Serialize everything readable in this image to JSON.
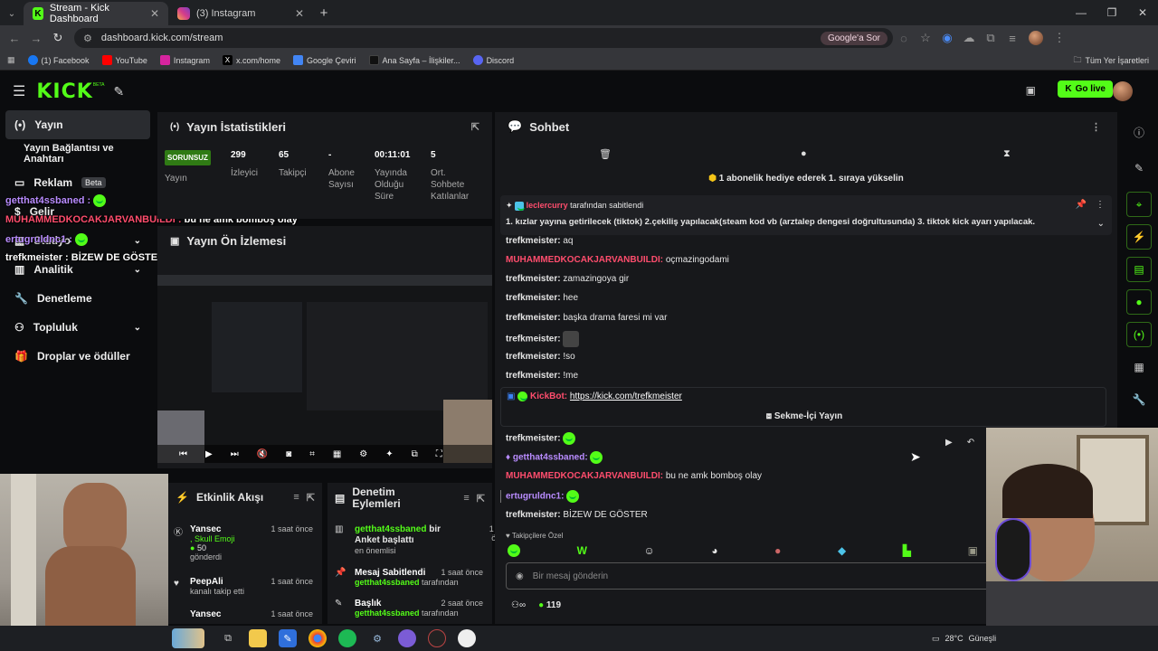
{
  "browser": {
    "tabs": [
      {
        "label": "Stream - Kick Dashboard"
      },
      {
        "label": "(3) Instagram"
      }
    ],
    "url": "dashboard.kick.com/stream",
    "ask_label": "Google'a Sor",
    "bookmarks": [
      {
        "label": "(1) Facebook",
        "color": "#1877f2"
      },
      {
        "label": "YouTube",
        "color": "#ff0000"
      },
      {
        "label": "Instagram",
        "color": "#d6249f"
      },
      {
        "label": "x.com/home",
        "color": "#000000"
      },
      {
        "label": "Google Çeviri",
        "color": "#4285f4"
      },
      {
        "label": "Ana Sayfa – İlişkiler...",
        "color": "#111111"
      },
      {
        "label": "Discord",
        "color": "#5865f2"
      }
    ],
    "all_bookmarks": "Tüm Yer İşaretleri"
  },
  "header": {
    "logo": "KICK",
    "logo_sup": "BETA",
    "go_live": "Go live",
    "accent": "#53fc18"
  },
  "sidebar": {
    "items": [
      {
        "label": "Yayın",
        "icon": "broadcast-icon"
      },
      {
        "label": "Yayın Bağlantısı ve Anahtarı"
      },
      {
        "label": "Reklam",
        "badge": "Beta"
      },
      {
        "label": "Gelir"
      },
      {
        "label": "Stüdyo"
      },
      {
        "label": "Analitik"
      },
      {
        "label": "Denetleme"
      },
      {
        "label": "Topluluk"
      },
      {
        "label": "Droplar ve ödüller"
      }
    ]
  },
  "overlay": {
    "lines": [
      {
        "user": "getthat4ssbaned :",
        "msg": ""
      },
      {
        "user": "MUHAMMEDKOCAKJARVANBUILDI :",
        "msg": "bu ne amk bomboş olay"
      },
      {
        "user": "ertugruldnc1 :",
        "msg": ""
      },
      {
        "user": "trefkmeister :",
        "msg": "BİZEW DE GÖSTER"
      }
    ]
  },
  "stats": {
    "title": "Yayın İstatistikleri",
    "status": "SORUNSUZ",
    "status_label": "Yayın",
    "items": [
      {
        "value": "299",
        "label": "İzleyici"
      },
      {
        "value": "65",
        "label": "Takipçi"
      },
      {
        "value": "-",
        "label": "Abone Sayısı"
      },
      {
        "value": "00:11:01",
        "label": "Yayında Olduğu Süre"
      },
      {
        "value": "5",
        "label": "Ort. Sohbete Katılanlar"
      }
    ]
  },
  "preview": {
    "title": "Yayın Ön İzlemesi"
  },
  "activity": {
    "title": "Etkinlik Akışı",
    "items": [
      {
        "name": "Yansec",
        "time": "1 saat önce",
        "detail": ", Skull Emoji",
        "amount": "50",
        "sub": "gönderdi"
      },
      {
        "name": "PeepAli",
        "time": "1 saat önce",
        "sub": "kanalı takip etti"
      },
      {
        "name": "Yansec",
        "time": "1 saat önce"
      }
    ]
  },
  "modactions": {
    "title": "Denetim Eylemleri",
    "items": [
      {
        "user": "getthat4ssbaned",
        "text": "bir Anket başlattı",
        "time": "1 saat önce",
        "sub": "en önemlisi"
      },
      {
        "title": "Mesaj Sabitlendi",
        "time": "1 saat önce",
        "user": "getthat4ssbaned",
        "sub": "tarafından"
      },
      {
        "title": "Başlık",
        "time": "2 saat önce",
        "user": "getthat4ssbaned",
        "sub": "tarafından"
      }
    ]
  },
  "chat": {
    "title": "Sohbet",
    "gift_banner": "1 abonelik hediye ederek 1. sıraya yükselin",
    "pinned_by": "leclercurry",
    "pinned_by_suffix": "tarafından sabitlendi",
    "pinned_text": "1. kızlar yayına getirilecek (tiktok) 2.çekiliş yapılacak(steam kod vb (arztalep dengesi doğrultusunda) 3. tiktok kick ayarı yapılacak.",
    "messages": [
      {
        "user": "trefkmeister:",
        "msg": "aq",
        "color": "#e5e5e5"
      },
      {
        "user": "MUHAMMEDKOCAKJARVANBUILDI:",
        "msg": "oçmazingodami",
        "color": "#ff4d6d"
      },
      {
        "user": "trefkmeister:",
        "msg": "zamazingoya gir",
        "color": "#e5e5e5"
      },
      {
        "user": "trefkmeister:",
        "msg": "hee",
        "color": "#e5e5e5"
      },
      {
        "user": "trefkmeister:",
        "msg": "başka drama faresi mi var",
        "color": "#e5e5e5"
      },
      {
        "user": "trefkmeister:",
        "msg": "",
        "color": "#e5e5e5"
      },
      {
        "user": "trefkmeister:",
        "msg": "!so",
        "color": "#e5e5e5"
      },
      {
        "user": "trefkmeister:",
        "msg": "!me",
        "color": "#e5e5e5"
      }
    ],
    "bot_user": "KickBot:",
    "bot_link": "https://kick.com/trefkmeister",
    "inner_stream": "Sekme-İçi Yayın",
    "messages2": [
      {
        "user": "trefkmeister:",
        "msg": "",
        "color": "#e5e5e5"
      },
      {
        "user": "getthat4ssbaned:",
        "msg": "",
        "color": "#b98cff"
      },
      {
        "user": "MUHAMMEDKOCAKJARVANBUILDI:",
        "msg": "bu ne amk bomboş olay",
        "color": "#ff4d6d"
      },
      {
        "user": "ertugruldnc1:",
        "msg": "",
        "color": "#b98cff"
      },
      {
        "user": "trefkmeister:",
        "msg": "BİZEW DE GÖSTER",
        "color": "#e5e5e5"
      }
    ],
    "followers_only": "Takipçilere Özel",
    "input_placeholder": "Bir mesaj gönderin",
    "points": "119"
  },
  "taskbar": {
    "weather": "28°C",
    "weather_desc": "Güneşli"
  }
}
